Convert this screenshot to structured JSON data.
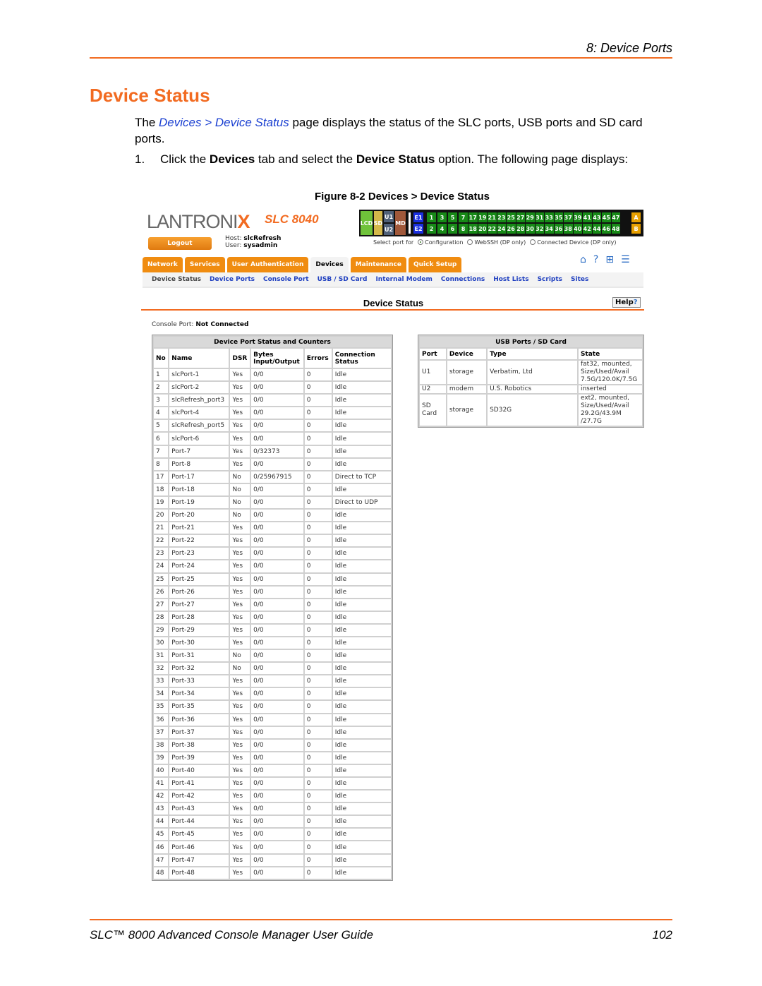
{
  "doc": {
    "chapter": "8: Device Ports",
    "section_title": "Device Status",
    "intro": {
      "prefix": "The ",
      "link": "Devices > Device Status",
      "suffix": " page displays the status of the SLC ports, USB ports and SD card ports."
    },
    "step": {
      "number": "1.",
      "t1": "Click the ",
      "b1": "Devices",
      "t2": " tab and select the ",
      "b2": "Device Status",
      "t3": " option. The following page displays:"
    },
    "figure_caption": "Figure 8-2  Devices > Device Status",
    "footer_title": "SLC™ 8000 Advanced Console Manager User Guide",
    "footer_page": "102"
  },
  "app": {
    "logo": "LANTRONIX",
    "model": "SLC 8040",
    "logout_label": "Logout",
    "host_label": "Host:",
    "host_value": "slcRefresh",
    "user_label": "User:",
    "user_value": "sysadmin",
    "port_grid": {
      "modules": [
        {
          "label": "LCD",
          "color": "#6fc23a"
        },
        {
          "label": "SD",
          "color": "#d4b84a"
        },
        {
          "label": "U1",
          "color": "#4f6078"
        },
        {
          "label": "U2",
          "color": "#4f6078"
        },
        {
          "label": "MD",
          "color": "#a0583a"
        }
      ],
      "eth": [
        {
          "label": "E1",
          "color": "#1a2fe0"
        },
        {
          "label": "E2",
          "color": "#1a2fe0"
        }
      ],
      "top_ports": [
        "1",
        "3",
        "5",
        "7",
        "17",
        "19",
        "21",
        "23",
        "25",
        "27",
        "29",
        "31",
        "33",
        "35",
        "37",
        "39",
        "41",
        "43",
        "45",
        "47"
      ],
      "bottom_ports": [
        "2",
        "4",
        "6",
        "8",
        "18",
        "20",
        "22",
        "24",
        "26",
        "28",
        "30",
        "32",
        "34",
        "36",
        "38",
        "40",
        "42",
        "44",
        "46",
        "48"
      ],
      "port_color": "#178a17",
      "aux": [
        {
          "label": "A",
          "color": "#e8a000"
        },
        {
          "label": "B",
          "color": "#e8a000"
        }
      ]
    },
    "select_port_for": {
      "label": "Select port for",
      "options": [
        {
          "label": "Configuration",
          "selected": true
        },
        {
          "label": "WebSSH (DP only)",
          "selected": false
        },
        {
          "label": "Connected Device (DP only)",
          "selected": false
        }
      ]
    },
    "tabs": [
      "Network",
      "Services",
      "User Authentication",
      "Devices",
      "Maintenance",
      "Quick Setup"
    ],
    "active_tab": "Devices",
    "top_icons": [
      "home-icon",
      "help-icon",
      "sitemap-icon",
      "log-icon"
    ],
    "subnav": [
      "Device Status",
      "Device Ports",
      "Console Port",
      "USB / SD Card",
      "Internal Modem",
      "Connections",
      "Host Lists",
      "Scripts",
      "Sites"
    ],
    "active_subnav": "Device Status",
    "page_title": "Device Status",
    "help_label": "Help",
    "console_label": "Console Port:",
    "console_value": "Not Connected",
    "ports_table": {
      "caption": "Device Port Status and Counters",
      "headers": [
        "No",
        "Name",
        "DSR",
        "Bytes Input/Output",
        "Errors",
        "Connection Status"
      ],
      "rows": [
        [
          "1",
          "slcPort-1",
          "Yes",
          "0/0",
          "0",
          "Idle"
        ],
        [
          "2",
          "slcPort-2",
          "Yes",
          "0/0",
          "0",
          "Idle"
        ],
        [
          "3",
          "slcRefresh_port3",
          "Yes",
          "0/0",
          "0",
          "Idle"
        ],
        [
          "4",
          "slcPort-4",
          "Yes",
          "0/0",
          "0",
          "Idle"
        ],
        [
          "5",
          "slcRefresh_port5",
          "Yes",
          "0/0",
          "0",
          "Idle"
        ],
        [
          "6",
          "slcPort-6",
          "Yes",
          "0/0",
          "0",
          "Idle"
        ],
        [
          "7",
          "Port-7",
          "Yes",
          "0/32373",
          "0",
          "Idle"
        ],
        [
          "8",
          "Port-8",
          "Yes",
          "0/0",
          "0",
          "Idle"
        ],
        [
          "17",
          "Port-17",
          "No",
          "0/25967915",
          "0",
          "Direct to TCP"
        ],
        [
          "18",
          "Port-18",
          "No",
          "0/0",
          "0",
          "Idle"
        ],
        [
          "19",
          "Port-19",
          "No",
          "0/0",
          "0",
          "Direct to UDP"
        ],
        [
          "20",
          "Port-20",
          "No",
          "0/0",
          "0",
          "Idle"
        ],
        [
          "21",
          "Port-21",
          "Yes",
          "0/0",
          "0",
          "Idle"
        ],
        [
          "22",
          "Port-22",
          "Yes",
          "0/0",
          "0",
          "Idle"
        ],
        [
          "23",
          "Port-23",
          "Yes",
          "0/0",
          "0",
          "Idle"
        ],
        [
          "24",
          "Port-24",
          "Yes",
          "0/0",
          "0",
          "Idle"
        ],
        [
          "25",
          "Port-25",
          "Yes",
          "0/0",
          "0",
          "Idle"
        ],
        [
          "26",
          "Port-26",
          "Yes",
          "0/0",
          "0",
          "Idle"
        ],
        [
          "27",
          "Port-27",
          "Yes",
          "0/0",
          "0",
          "Idle"
        ],
        [
          "28",
          "Port-28",
          "Yes",
          "0/0",
          "0",
          "Idle"
        ],
        [
          "29",
          "Port-29",
          "Yes",
          "0/0",
          "0",
          "Idle"
        ],
        [
          "30",
          "Port-30",
          "Yes",
          "0/0",
          "0",
          "Idle"
        ],
        [
          "31",
          "Port-31",
          "No",
          "0/0",
          "0",
          "Idle"
        ],
        [
          "32",
          "Port-32",
          "No",
          "0/0",
          "0",
          "Idle"
        ],
        [
          "33",
          "Port-33",
          "Yes",
          "0/0",
          "0",
          "Idle"
        ],
        [
          "34",
          "Port-34",
          "Yes",
          "0/0",
          "0",
          "Idle"
        ],
        [
          "35",
          "Port-35",
          "Yes",
          "0/0",
          "0",
          "Idle"
        ],
        [
          "36",
          "Port-36",
          "Yes",
          "0/0",
          "0",
          "Idle"
        ],
        [
          "37",
          "Port-37",
          "Yes",
          "0/0",
          "0",
          "Idle"
        ],
        [
          "38",
          "Port-38",
          "Yes",
          "0/0",
          "0",
          "Idle"
        ],
        [
          "39",
          "Port-39",
          "Yes",
          "0/0",
          "0",
          "Idle"
        ],
        [
          "40",
          "Port-40",
          "Yes",
          "0/0",
          "0",
          "Idle"
        ],
        [
          "41",
          "Port-41",
          "Yes",
          "0/0",
          "0",
          "Idle"
        ],
        [
          "42",
          "Port-42",
          "Yes",
          "0/0",
          "0",
          "Idle"
        ],
        [
          "43",
          "Port-43",
          "Yes",
          "0/0",
          "0",
          "Idle"
        ],
        [
          "44",
          "Port-44",
          "Yes",
          "0/0",
          "0",
          "Idle"
        ],
        [
          "45",
          "Port-45",
          "Yes",
          "0/0",
          "0",
          "Idle"
        ],
        [
          "46",
          "Port-46",
          "Yes",
          "0/0",
          "0",
          "Idle"
        ],
        [
          "47",
          "Port-47",
          "Yes",
          "0/0",
          "0",
          "Idle"
        ],
        [
          "48",
          "Port-48",
          "Yes",
          "0/0",
          "0",
          "Idle"
        ]
      ]
    },
    "usb_table": {
      "caption": "USB Ports / SD Card",
      "headers": [
        "Port",
        "Device",
        "Type",
        "State"
      ],
      "rows": [
        [
          "U1",
          "storage",
          "Verbatim, Ltd",
          "fat32, mounted, Size/Used/Avail 7.5G/120.0K/7.5G"
        ],
        [
          "U2",
          "modem",
          "U.S. Robotics",
          "inserted"
        ],
        [
          "SD Card",
          "storage",
          "SD32G",
          "ext2, mounted, Size/Used/Avail 29.2G/43.9M /27.7G"
        ]
      ]
    }
  }
}
